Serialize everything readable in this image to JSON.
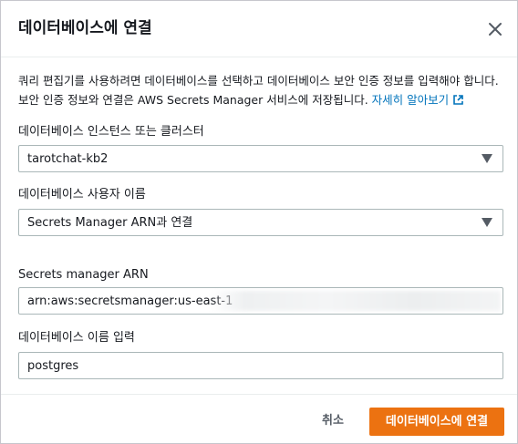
{
  "modal": {
    "title": "데이터베이스에 연결",
    "close_icon": "close-icon"
  },
  "description": {
    "line1": "쿼리 편집기를 사용하려면 데이터베이스를 선택하고 데이터베이스 보안 인증 정보를 입력해야 합니다.",
    "line2": "보안 인증 정보와 연결은 AWS Secrets Manager 서비스에 저장됩니다. ",
    "link_text": "자세히 알아보기",
    "link_icon": "external-link-icon"
  },
  "fields": {
    "instance": {
      "label": "데이터베이스 인스턴스 또는 클러스터",
      "value": "tarotchat-kb2"
    },
    "username": {
      "label": "데이터베이스 사용자 이름",
      "value": "Secrets Manager ARN과 연결"
    },
    "arn": {
      "label": "Secrets manager ARN",
      "value": "arn:aws:secretsmanager:us-east-1"
    },
    "dbname": {
      "label": "데이터베이스 이름 입력",
      "value": "postgres"
    }
  },
  "footer": {
    "cancel_label": "취소",
    "connect_label": "데이터베이스에 연결"
  },
  "colors": {
    "primary": "#ec7211",
    "link": "#0073bb",
    "text": "#16191f"
  }
}
